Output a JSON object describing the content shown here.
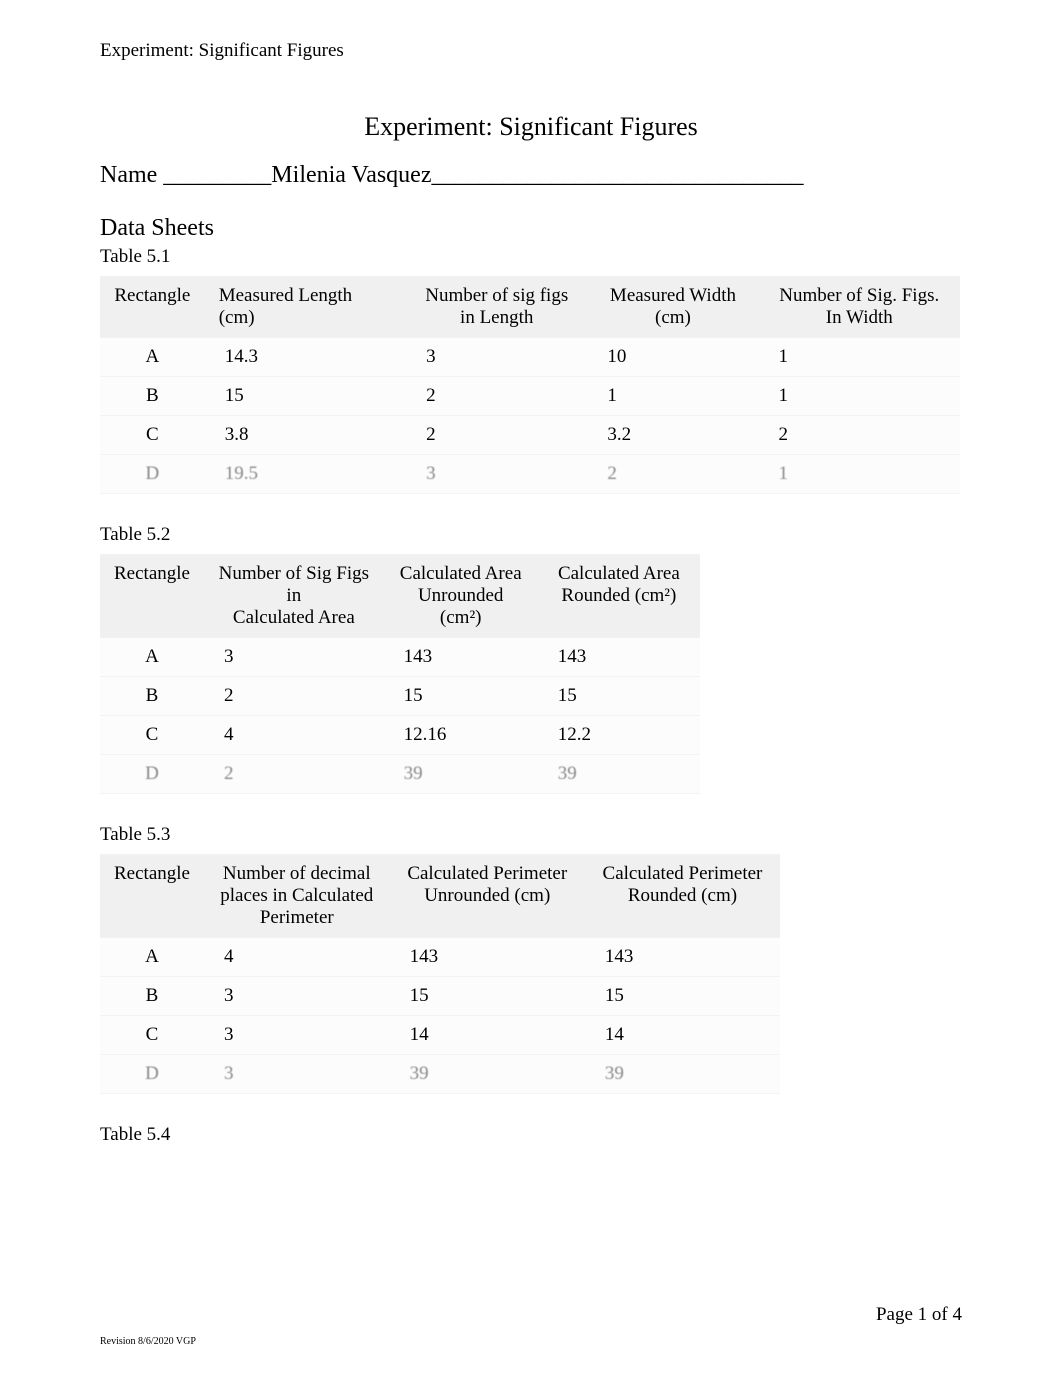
{
  "header": "Experiment: Significant Figures",
  "title": "Experiment: Significant Figures",
  "name_label": "Name _________Milenia Vasquez_______________________________",
  "data_sheets": "Data Sheets",
  "table51": {
    "label": "Table 5.1",
    "headers": {
      "c1": "Rectangle",
      "c2": "Measured Length (cm)",
      "c3a": "Number of sig figs",
      "c3b": "in Length",
      "c4a": "Measured Width",
      "c4b": "(cm)",
      "c5a": "Number of Sig. Figs.",
      "c5b": "In Width"
    },
    "rows": [
      {
        "r": "A",
        "len": "14.3",
        "sfl": "3",
        "wid": "10",
        "sfw": "1"
      },
      {
        "r": "B",
        "len": "15",
        "sfl": "2",
        "wid": "1",
        "sfw": "1"
      },
      {
        "r": "C",
        "len": "3.8",
        "sfl": "2",
        "wid": "3.2",
        "sfw": "2"
      },
      {
        "r": "D",
        "len": "19.5",
        "sfl": "3",
        "wid": "2",
        "sfw": "1"
      }
    ]
  },
  "table52": {
    "label": "Table 5.2",
    "headers": {
      "c1": "Rectangle",
      "c2a": "Number of Sig Figs in",
      "c2b": "Calculated Area",
      "c3a": "Calculated Area",
      "c3b": "Unrounded (cm²)",
      "c4a": "Calculated Area",
      "c4b": "Rounded (cm²)"
    },
    "rows": [
      {
        "r": "A",
        "sf": "3",
        "unr": "143",
        "rnd": "143"
      },
      {
        "r": "B",
        "sf": "2",
        "unr": "15",
        "rnd": "15"
      },
      {
        "r": "C",
        "sf": "4",
        "unr": "12.16",
        "rnd": "12.2"
      },
      {
        "r": "D",
        "sf": "2",
        "unr": "39",
        "rnd": "39"
      }
    ]
  },
  "table53": {
    "label": "Table 5.3",
    "headers": {
      "c1": "Rectangle",
      "c2a": "Number of decimal",
      "c2b": "places in Calculated",
      "c2c": "Perimeter",
      "c3a": "Calculated Perimeter",
      "c3b": "Unrounded (cm)",
      "c4a": "Calculated Perimeter",
      "c4b": "Rounded (cm)"
    },
    "rows": [
      {
        "r": "A",
        "dp": "4",
        "unr": "143",
        "rnd": "143"
      },
      {
        "r": "B",
        "dp": "3",
        "unr": "15",
        "rnd": "15"
      },
      {
        "r": "C",
        "dp": "3",
        "unr": "14",
        "rnd": "14"
      },
      {
        "r": "D",
        "dp": "3",
        "unr": "39",
        "rnd": "39"
      }
    ]
  },
  "table54_label": "Table 5.4",
  "footer": {
    "page": "Page 1 of 4",
    "revision": "Revision 8/6/2020 VGP"
  }
}
